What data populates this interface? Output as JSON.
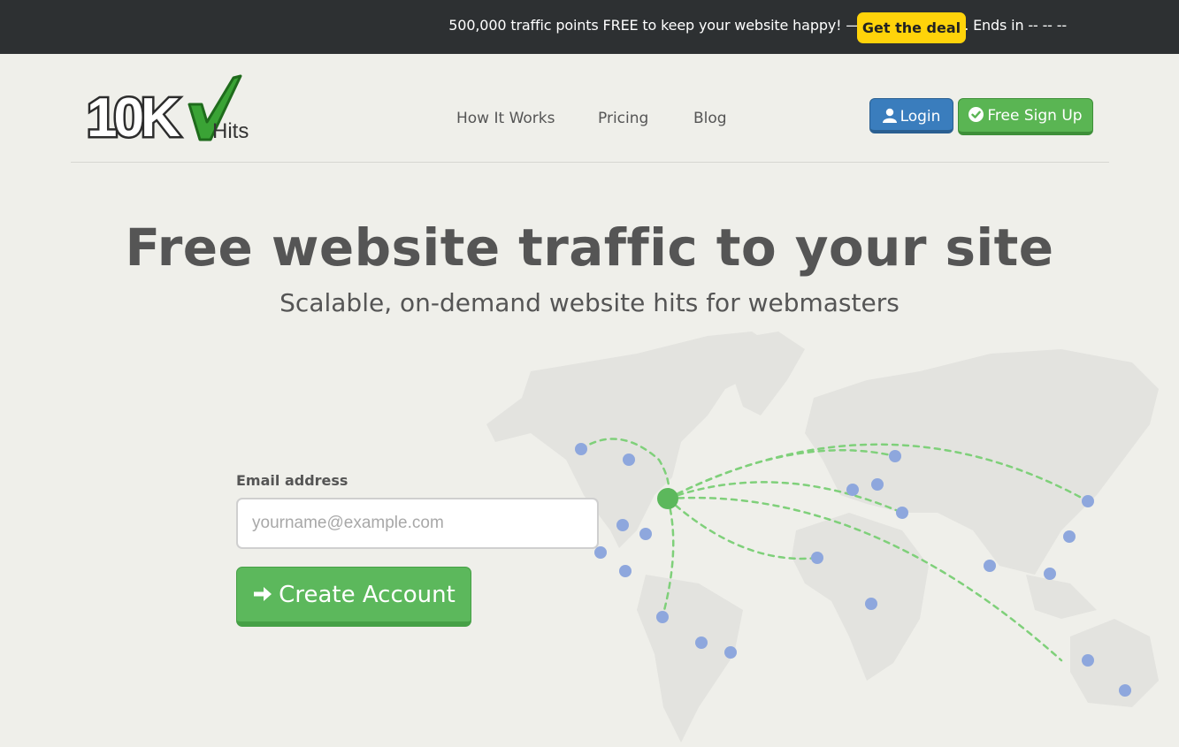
{
  "promo": {
    "text": "500,000 traffic points FREE to keep your website happy! — Limited supply. Ends in -- -- --",
    "cta": "Get the deal"
  },
  "brand": {
    "logo_main": "10K",
    "logo_sub": "Hits"
  },
  "nav": {
    "items": [
      "How It Works",
      "Pricing",
      "Blog"
    ]
  },
  "auth": {
    "login": "Login",
    "signup": "Free Sign Up"
  },
  "hero": {
    "title": "Free website traffic to your site",
    "subtitle": "Scalable, on-demand website hits for webmasters"
  },
  "form": {
    "email_label": "Email address",
    "email_placeholder": "yourname@example.com",
    "submit": "Create Account"
  },
  "colors": {
    "promo_bg": "#2d3032",
    "deal": "#ffd30a",
    "login": "#3a7dbd",
    "signup": "#5ab553",
    "map_dot": "#8ea7dd",
    "hub": "#5cb85c"
  }
}
